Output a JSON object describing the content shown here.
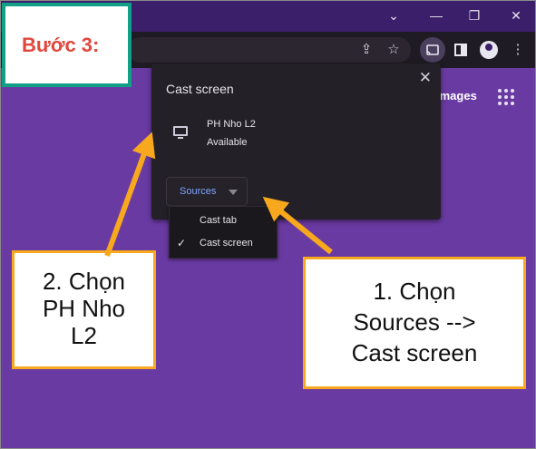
{
  "step": {
    "label": "Bước 3:"
  },
  "page": {
    "images_link": "Images"
  },
  "cast_dialog": {
    "title": "Cast screen",
    "device": {
      "name": "PH Nho L2",
      "status": "Available"
    },
    "sources_button": "Sources",
    "sources_menu": [
      "Cast tab",
      "Cast screen"
    ],
    "selected_source": "Cast screen"
  },
  "callouts": {
    "left": [
      "2. Chọn",
      "PH Nho",
      "L2"
    ],
    "right": [
      "1. Chọn",
      "Sources -->",
      "Cast screen"
    ]
  },
  "colors": {
    "accent": "#f7a81d",
    "step_border": "#11a085",
    "step_text": "#e1473c",
    "page_bg": "#6a3aa3"
  },
  "icons": [
    "share-icon",
    "star-icon",
    "cast-icon",
    "sidebar-icon",
    "profile-icon",
    "more-icon",
    "apps-grid-icon",
    "close-icon",
    "monitor-icon",
    "chevron-down-icon",
    "minimize-icon",
    "restore-icon",
    "close-window-icon",
    "check-icon"
  ]
}
